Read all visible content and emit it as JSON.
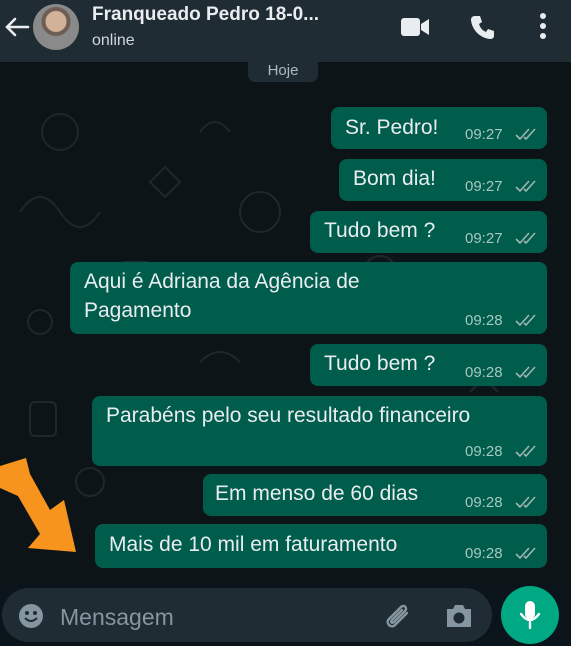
{
  "header": {
    "contact_name": "Franqueado Pedro 18-0...",
    "status": "online"
  },
  "chat": {
    "day_label": "Hoje",
    "messages": [
      {
        "text": "Sr. Pedro!",
        "time": "09:27"
      },
      {
        "text": "Bom dia!",
        "time": "09:27"
      },
      {
        "text": "Tudo bem ?",
        "time": "09:27"
      },
      {
        "line1": "Aqui é Adriana da Agência de",
        "line2": "Pagamento",
        "time": "09:28"
      },
      {
        "text": "Tudo bem ?",
        "time": "09:28"
      },
      {
        "text": "Parabéns pelo seu resultado financeiro",
        "time": "09:28"
      },
      {
        "text": "Em menso de 60 dias",
        "time": "09:28"
      },
      {
        "text": "Mais de 10 mil em faturamento",
        "time": "09:28"
      }
    ]
  },
  "composer": {
    "placeholder": "Mensagem"
  },
  "colors": {
    "header_bg": "#1f2c33",
    "bubble_out": "#005c4b",
    "accent": "#00a884",
    "annotation_arrow": "#f7941d"
  },
  "icons": [
    "back-arrow-icon",
    "video-call-icon",
    "voice-call-icon",
    "more-options-icon",
    "emoji-icon",
    "attach-icon",
    "camera-icon",
    "mic-icon",
    "double-check-icon"
  ]
}
